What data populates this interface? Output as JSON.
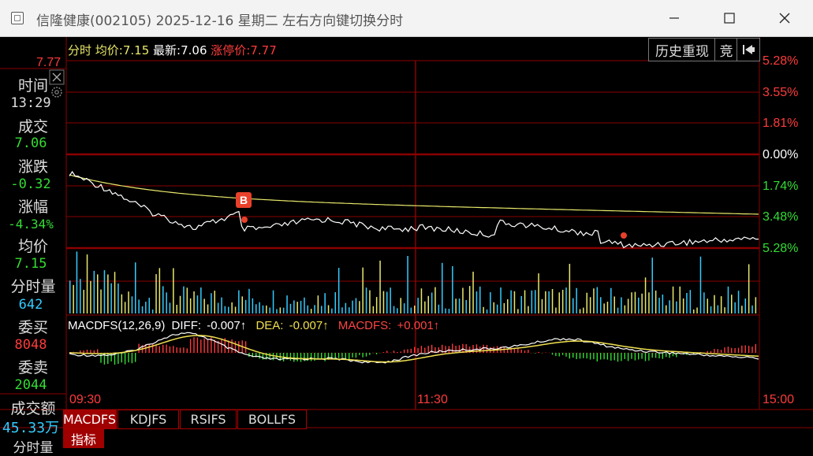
{
  "window": {
    "title": "信隆健康(002105) 2025-12-16 星期二      左右方向键切换分时"
  },
  "header": {
    "fenshi": "分时",
    "avg_label": "均价:",
    "avg_value": "7.15",
    "latest_label": "最新:",
    "latest_value": "7.06",
    "limit_label": "涨停价:",
    "limit_value": "7.77"
  },
  "buttons": {
    "history": "历史重现",
    "auction": "竞",
    "back_icon": "back-to-start-icon"
  },
  "left_axis": {
    "top_price": "7.77"
  },
  "right_axis": {
    "labels": [
      "5.28%",
      "3.55%",
      "1.81%",
      "0.00%",
      "1.74%",
      "3.48%",
      "5.28%"
    ],
    "colors": [
      "#ff3b3b",
      "#ff3b3b",
      "#ff3b3b",
      "#ffffff",
      "#33dd33",
      "#33dd33",
      "#33dd33"
    ]
  },
  "sidebar": {
    "time_label": "时间",
    "time_value": "13:29",
    "volume_label": "成交",
    "volume_value": "7.06",
    "change_label": "涨跌",
    "change_value": "-0.32",
    "pct_label": "涨幅",
    "pct_value": "-4.34%",
    "avg_label": "均价",
    "avg_value": "7.15",
    "minvol_label": "分时量",
    "minvol_value": "642",
    "bid_label": "委买",
    "bid_value": "8048",
    "ask_label": "委卖",
    "ask_value": "2044",
    "amount_label": "成交额",
    "amount_value": "45.33万",
    "bottom_partial": "分时量"
  },
  "indicator": {
    "name": "MACDFS(12,26,9)",
    "diff_label": "DIFF:",
    "diff_value": "-0.007↑",
    "dea_label": "DEA:",
    "dea_value": "-0.007↑",
    "macd_label": "MACDFS:",
    "macd_value": "+0.001↑"
  },
  "time_axis": {
    "start": "09:30",
    "mid": "11:30",
    "end": "15:00"
  },
  "marker": {
    "buy_label": "B"
  },
  "tabs": {
    "items": [
      "MACDFS",
      "KDJFS",
      "RSIFS",
      "BOLLFS"
    ],
    "indicator_tab": "指标"
  },
  "colors": {
    "grid": "#8b0000",
    "up": "#ff3b3b",
    "down": "#33dd33",
    "avg_line": "#e8e86a",
    "price_line": "#ffffff"
  }
}
